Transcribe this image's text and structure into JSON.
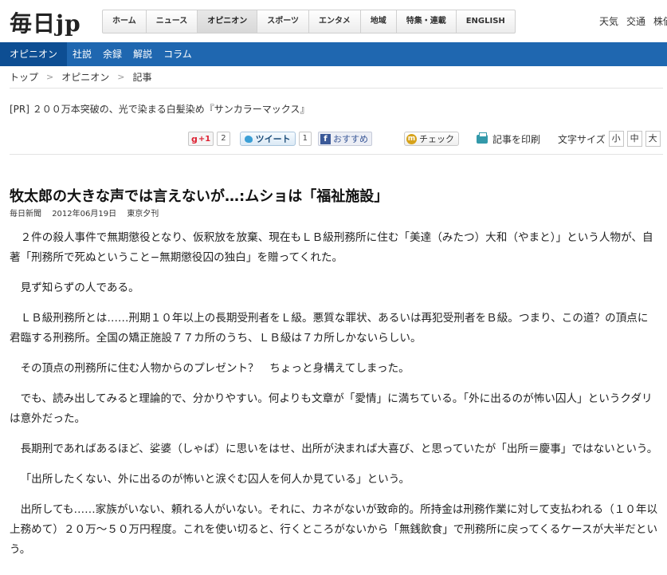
{
  "header": {
    "logo_main": "毎日",
    "logo_suffix": "jp",
    "nav": [
      "ホーム",
      "ニュース",
      "オピニオン",
      "スポーツ",
      "エンタメ",
      "地域",
      "特集・連載",
      "ENGLISH"
    ],
    "nav_active_index": 2,
    "util_links": [
      "天気",
      "交通",
      "株価"
    ]
  },
  "subnav": {
    "current": "オピニオン",
    "items": [
      "社説",
      "余録",
      "解説",
      "コラム"
    ]
  },
  "breadcrumb": {
    "items": [
      "トップ",
      "オピニオン",
      "記事"
    ],
    "separator": ">"
  },
  "pr": {
    "tag": "[PR]",
    "text": "２００万本突破の、光で染まる白髪染め『サンカラーマックス』"
  },
  "toolbar": {
    "gplus_label": "+1",
    "gplus_count": "2",
    "tweet_label": "ツイート",
    "tweet_count": "1",
    "fb_label": "おすすめ",
    "check_label": "チェック",
    "print_label": "記事を印刷",
    "font_size_label": "文字サイズ",
    "font_sizes": [
      "小",
      "中",
      "大"
    ]
  },
  "article": {
    "title": "牧太郎の大きな声では言えないが…:ムショは「福祉施設」",
    "source": "毎日新聞",
    "date": "2012年06月19日",
    "edition": "東京夕刊",
    "paragraphs": [
      "２件の殺人事件で無期懲役となり、仮釈放を放棄、現在もＬＢ級刑務所に住む「美達（みたつ）大和（やまと）」という人物が、自著「刑務所で死ぬということ−無期懲役囚の独白」を贈ってくれた。",
      "見ず知らずの人である。",
      "ＬＢ級刑務所とは……刑期１０年以上の長期受刑者をＬ級。悪質な罪状、あるいは再犯受刑者をＢ級。つまり、この道？の頂点に君臨する刑務所。全国の矯正施設７７カ所のうち、ＬＢ級は７カ所しかないらしい。",
      "その頂点の刑務所に住む人物からのプレゼント？　ちょっと身構えてしまった。",
      "でも、読み出してみると理論的で、分かりやすい。何よりも文章が「愛情」に満ちている。「外に出るのが怖い囚人」というクダリは意外だった。",
      "長期刑であればあるほど、娑婆（しゃば）に思いをはせ、出所が決まれば大喜び、と思っていたが「出所＝慶事」ではないという。",
      "「出所したくない、外に出るのが怖いと涙ぐむ囚人を何人か見ている」という。",
      "出所しても……家族がいない、頼れる人がいない。それに、カネがないが致命的。所持金は刑務作業に対して支払われる（１０年以上務めて）２０万〜５０万円程度。これを使い切ると、行くところがないから「無銭飲食」で刑務所に戻ってくるケースが大半だという。"
    ]
  }
}
